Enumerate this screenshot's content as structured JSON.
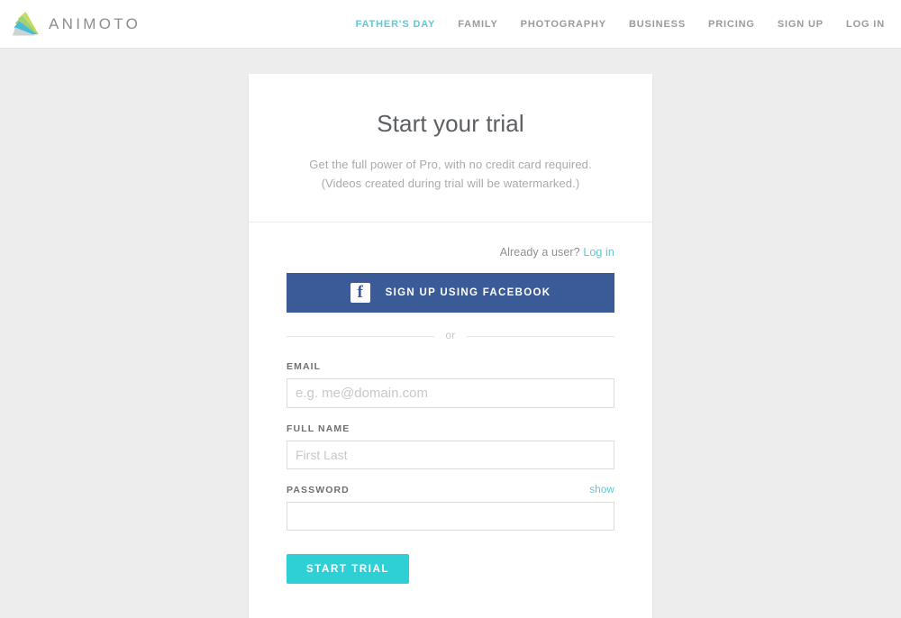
{
  "header": {
    "brand": {
      "wordmark": "ANIMOTO",
      "logo_icon": "animoto-triangle-logo",
      "colors": {
        "green": "#b6d95c",
        "teal": "#3ec1d8",
        "gray": "#cfd2d4"
      }
    },
    "nav": [
      {
        "label": "FATHER'S DAY",
        "accent": true
      },
      {
        "label": "FAMILY",
        "accent": false
      },
      {
        "label": "PHOTOGRAPHY",
        "accent": false
      },
      {
        "label": "BUSINESS",
        "accent": false
      },
      {
        "label": "PRICING",
        "accent": false
      },
      {
        "label": "SIGN UP",
        "accent": false
      },
      {
        "label": "LOG IN",
        "accent": false
      }
    ]
  },
  "card": {
    "title": "Start your trial",
    "subtitle_line1": "Get the full power of Pro, with no credit card required.",
    "subtitle_line2": "(Videos created during trial will be watermarked.)",
    "already_user_text": "Already a user?",
    "already_user_link": "Log in",
    "facebook_button": {
      "label": "SIGN UP USING FACEBOOK",
      "icon": "facebook-icon",
      "color": "#3a5a98"
    },
    "divider_word": "or",
    "fields": [
      {
        "label": "EMAIL",
        "placeholder": "e.g. me@domain.com",
        "value": "",
        "type": "email",
        "aux": ""
      },
      {
        "label": "FULL NAME",
        "placeholder": "First Last",
        "value": "",
        "type": "text",
        "aux": ""
      },
      {
        "label": "PASSWORD",
        "placeholder": "",
        "value": "",
        "type": "password",
        "aux": "show"
      }
    ],
    "submit_label": "START TRIAL",
    "accent_color": "#2ed0d6"
  }
}
